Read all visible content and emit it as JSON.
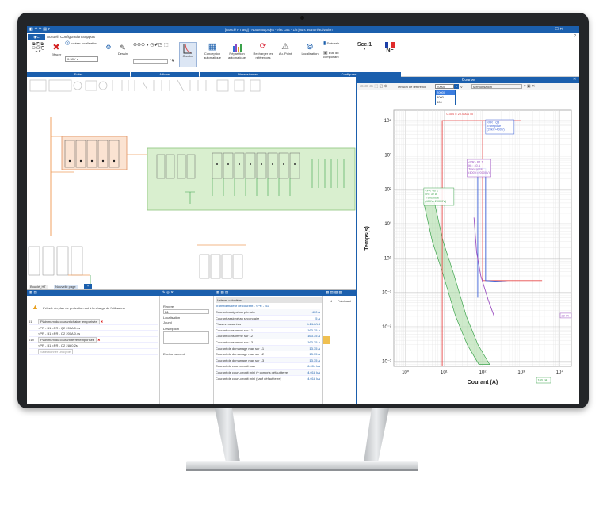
{
  "window": {
    "title": "[Bouclé HT avg] - Nouveau projet - elec calc - 1/8 jours avant réactivation",
    "controls": "—  ☐  ✕"
  },
  "menu": {
    "items": [
      "Accueil",
      "Configuration",
      "Support"
    ]
  },
  "ribbon": {
    "edit": {
      "label": "Editer",
      "effacer": "Effacer",
      "insert_loc": "Insérer localisation",
      "dessin": "Dessin",
      "zoom_value": "0.98V"
    },
    "afficher": {
      "label": "Afficher",
      "courbe": "Courbe"
    },
    "dimensionner": {
      "label": "Dimensionner",
      "conception": "Conception automatique",
      "repartition": "Répartition automatique",
      "recharger": "Recharger les références",
      "aucun": "Au. Point"
    },
    "configurer": {
      "label": "Configurer",
      "localisation": "Localisation",
      "scenario": "Scénario",
      "etat": "État du composant",
      "sce": "Sce.1",
      "norme": "NF"
    }
  },
  "tabs": {
    "items": [
      "Bouclé_HT",
      "Nouvelle page"
    ]
  },
  "curve": {
    "title": "Courbe",
    "toolbar": {
      "tension_label": "Tension de référence",
      "tension_value": "20000",
      "memo": "Mémorisation"
    },
    "tension_options": [
      "20000",
      "3000",
      "400"
    ],
    "labels": {
      "qb": "0.354 T: 20.000A T0",
      "q8": "<PR - Q8\nTransposé\n(20kV>400V)",
      "q2_title": "<PR - B1 T\nIth : 40 A\nTransposé\n(400V>20000V)",
      "q2": "<PR - B 1'\nIth : 32 A\nTransposé\n(400V>20000V)",
      "right_tag": "22 kA",
      "bottom_tag": "100 kA"
    },
    "chart_data": {
      "type": "line",
      "xlabel": "Courant (A)",
      "ylabel": "Temps(s)",
      "x_scale": "log",
      "y_scale": "log",
      "xlim": [
        0.5,
        20000
      ],
      "ylim": [
        0.0007,
        20000
      ],
      "x_ticks": [
        "10⁰",
        "10¹",
        "10²",
        "10³",
        "10⁴"
      ],
      "y_ticks": [
        "10⁴",
        "10³",
        "10²",
        "10¹",
        "10⁰",
        "10⁻¹",
        "10⁻²",
        "10⁻³"
      ],
      "grid": true,
      "series": [
        {
          "name": "red",
          "color": "#e84a4a",
          "points": [
            [
              9,
              10000
            ],
            [
              9,
              0.0007
            ],
            [
              1000,
              10000
            ]
          ]
        },
        {
          "name": "blue",
          "color": "#3a5fd6",
          "points": [
            [
              75,
              0.07
            ],
            [
              75,
              400
            ],
            [
              120,
              400
            ],
            [
              120,
              0.22
            ],
            [
              500,
              0.2
            ],
            [
              3500,
              0.2
            ]
          ]
        },
        {
          "name": "purple",
          "color": "#9b4fc1",
          "points": [
            [
              60,
              15
            ],
            [
              70,
              1.5
            ],
            [
              90,
              0.3
            ],
            [
              140,
              0.06
            ],
            [
              200,
              0.02
            ]
          ]
        },
        {
          "name": "green",
          "color": "#3aa24a",
          "points": [
            [
              3,
              40
            ],
            [
              5,
              3
            ],
            [
              9,
              0.4
            ],
            [
              20,
              0.02
            ],
            [
              40,
              0.003
            ],
            [
              80,
              0.0008
            ]
          ]
        }
      ]
    }
  },
  "bottom": {
    "warning": "L'étude du plan de protection est à la charge de l'utilisateur",
    "left_rows": [
      {
        "n": "01",
        "label": "Plainmum du courant chaine temporisée"
      },
      {
        "n": "",
        "label": "<PR - B1   <PR - Q2   200A   0.4s"
      },
      {
        "n": "",
        "label": "<PR - B1   <PR - Q2   200A   0.4s"
      },
      {
        "n": "01b",
        "label": "Plainmum du courant terre temporisée"
      },
      {
        "n": "",
        "label": "<PR - B1   <PR - Q2   2IA    0.2s"
      },
      {
        "n": "",
        "label": "Sélectionner un cycle"
      }
    ],
    "props": {
      "repere_label": "Repère",
      "repere": "B1",
      "loc_label": "Localisation",
      "loc": "Jouml",
      "desc_label": "Description",
      "env_label": "Environnement"
    },
    "valeurs": {
      "header": "Valeurs calculées",
      "transfo": "Transformateur de courant - <PR - B1",
      "rows": [
        [
          "Courant assigné au primaire",
          "400 A"
        ],
        [
          "Courant assigné au secondaire",
          "5 A"
        ],
        [
          "Phases mesurées",
          "L1/L2/L3"
        ],
        [
          "Courant consommé sur L1",
          "163.35 A"
        ],
        [
          "Courant consommé sur L2",
          "163.35 A"
        ],
        [
          "Courant consommé sur L3",
          "163.35 A"
        ],
        [
          "Courant de démarrage max sur L1",
          "13.35 A"
        ],
        [
          "Courant de démarrage max sur L2",
          "13.35 A"
        ],
        [
          "Courant de démarrage max sur L3",
          "13.35 A"
        ],
        [
          "Courant de court-circuit max",
          "6.004 kA"
        ],
        [
          "Courant de court-circuit mini (y compris défaut terre)",
          "4.018 kA"
        ],
        [
          "Courant de court-circuit mini (sauf défaut terre)",
          "4.018 kA"
        ]
      ]
    },
    "far": {
      "col1": "N",
      "col2": "Fabricant"
    }
  }
}
